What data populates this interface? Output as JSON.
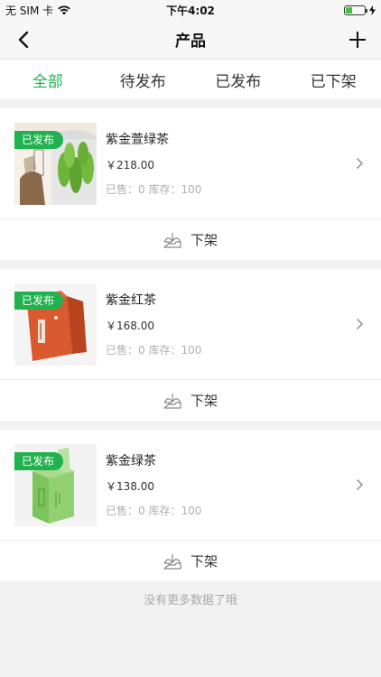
{
  "status": {
    "carrier": "无 SIM 卡",
    "time": "下午4:02",
    "battery_level": 0.35
  },
  "nav": {
    "title": "产品"
  },
  "tabs": [
    {
      "label": "全部",
      "active": true
    },
    {
      "label": "待发布",
      "active": false
    },
    {
      "label": "已发布",
      "active": false
    },
    {
      "label": "已下架",
      "active": false
    }
  ],
  "products": [
    {
      "name": "紫金萱绿茶",
      "price": "￥218.00",
      "stats": "已售：0   库存：100",
      "badge": "已发布",
      "action": "下架"
    },
    {
      "name": "紫金红茶",
      "price": "￥168.00",
      "stats": "已售：0   库存：100",
      "badge": "已发布",
      "action": "下架"
    },
    {
      "name": "紫金绿茶",
      "price": "￥138.00",
      "stats": "已售：0   库存：100",
      "badge": "已发布",
      "action": "下架"
    }
  ],
  "footer": {
    "note": "没有更多数据了哦"
  },
  "colors": {
    "accent": "#21b24f"
  }
}
